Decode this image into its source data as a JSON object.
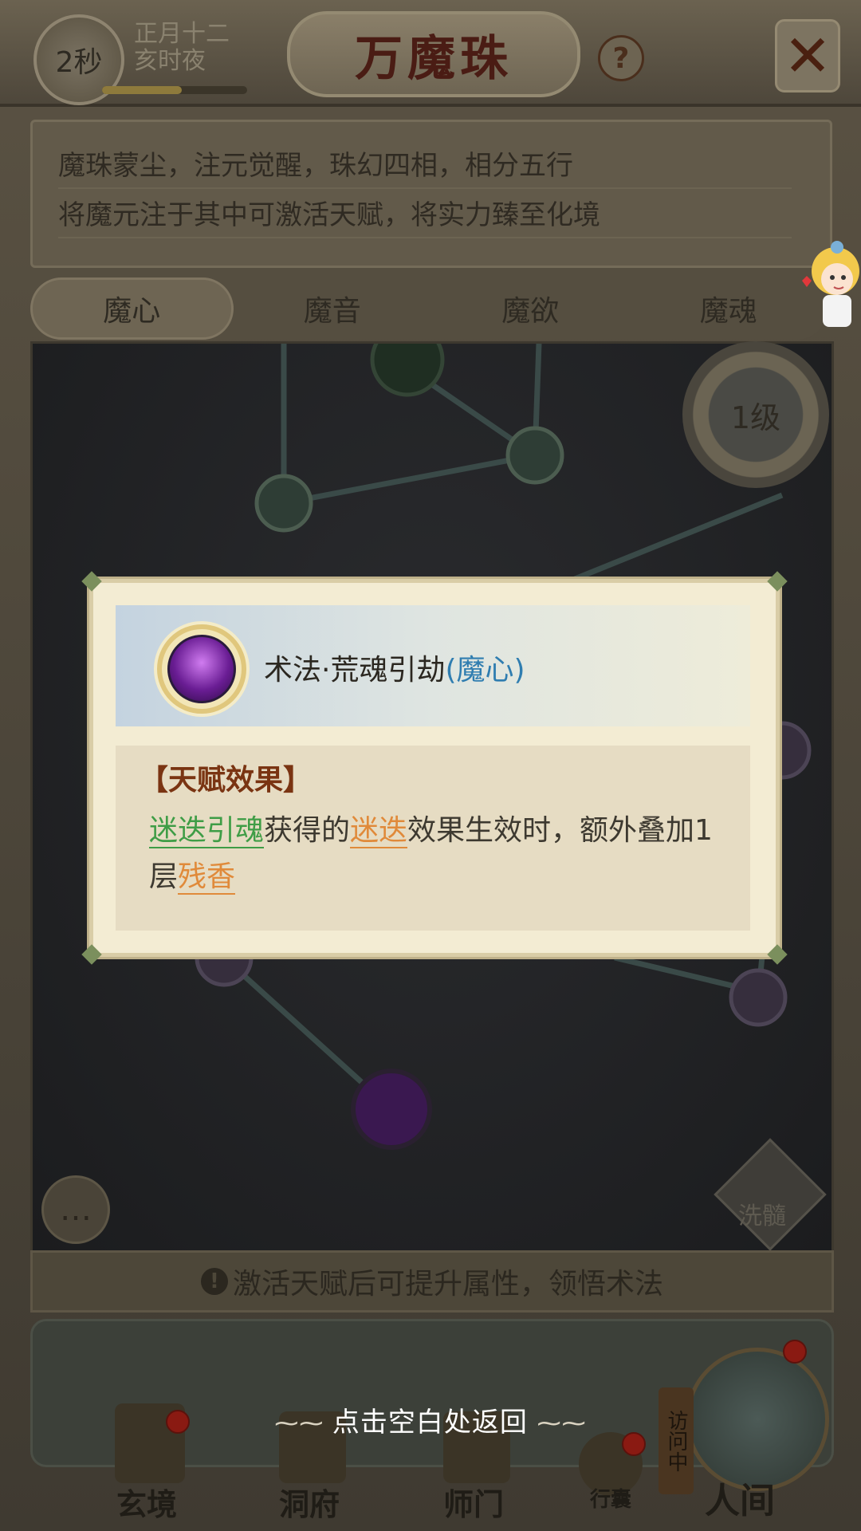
{
  "header": {
    "timer": "2秒",
    "date_line1": "正月十二",
    "date_line2": "亥时夜",
    "title": "万魔珠",
    "help": "?",
    "close": "✕",
    "timer_progress": 0.55
  },
  "description": {
    "line1": "魔珠蒙尘，注元觉醒，珠幻四相，相分五行",
    "line2": "将魔元注于其中可激活天赋，将实力臻至化境"
  },
  "tabs": [
    {
      "label": "魔心",
      "active": true
    },
    {
      "label": "魔音",
      "active": false
    },
    {
      "label": "魔欲",
      "active": false
    },
    {
      "label": "魔魂",
      "active": false
    }
  ],
  "board": {
    "level": "1级",
    "wash_label": "洗髓"
  },
  "hint": {
    "text": "激活天赋后可提升属性，领悟术法"
  },
  "popup": {
    "skill_name": "术法·荒魂引劫",
    "skill_tag": "(魔心)",
    "effect_title": "【天赋效果】",
    "effect_parts": {
      "p1": "迷迭引魂",
      "p2": "获得的",
      "p3": "迷迭",
      "p4": "效果生效时，额外叠加1层",
      "p5": "残香"
    }
  },
  "return_text": "点击空白处返回",
  "nav": {
    "xuanjing": "玄境",
    "dongfu": "洞府",
    "shimen": "师门",
    "xingnang": "行囊",
    "renjian": "人间",
    "visiting": "访问中"
  },
  "colors": {
    "popup_bg": "#f3ecd3",
    "keyword_green": "#3f9d46",
    "keyword_orange": "#e08a3a",
    "tag_blue": "#2f7db0",
    "effect_title": "#7a3412"
  }
}
